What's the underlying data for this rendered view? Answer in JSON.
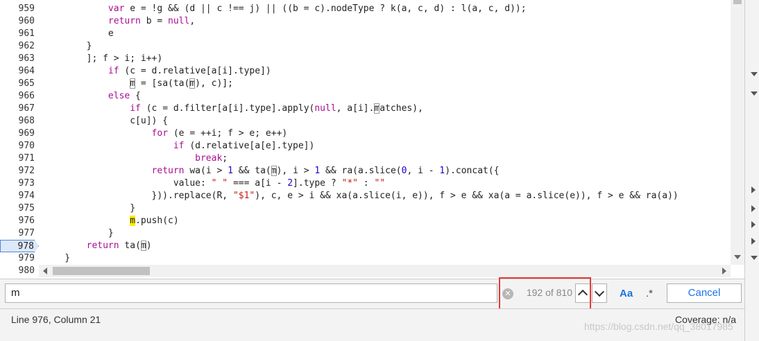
{
  "editor": {
    "active_line": "978",
    "lines": [
      {
        "num": "959",
        "tokens": [
          {
            "t": "            "
          },
          {
            "t": "var",
            "c": "kw"
          },
          {
            "t": " e = !g && (d || c !== j) || ((b = c).nodeType ? k(a, c, d) : l(a, c, d));"
          }
        ]
      },
      {
        "num": "960",
        "tokens": [
          {
            "t": "            "
          },
          {
            "t": "return",
            "c": "kw"
          },
          {
            "t": " b = "
          },
          {
            "t": "null",
            "c": "kw"
          },
          {
            "t": ","
          }
        ]
      },
      {
        "num": "961",
        "tokens": [
          {
            "t": "            e"
          }
        ]
      },
      {
        "num": "962",
        "tokens": [
          {
            "t": "        }"
          }
        ]
      },
      {
        "num": "963",
        "tokens": [
          {
            "t": "        ]; f > i; i++)"
          }
        ]
      },
      {
        "num": "964",
        "tokens": [
          {
            "t": "            "
          },
          {
            "t": "if",
            "c": "kw"
          },
          {
            "t": " (c = d.relative[a[i].type])"
          }
        ]
      },
      {
        "num": "965",
        "tokens": [
          {
            "t": "                "
          },
          {
            "t": "m",
            "c": "match"
          },
          {
            "t": " = [sa(ta("
          },
          {
            "t": "m",
            "c": "match"
          },
          {
            "t": "), c)];"
          }
        ]
      },
      {
        "num": "966",
        "tokens": [
          {
            "t": "            "
          },
          {
            "t": "else",
            "c": "kw"
          },
          {
            "t": " {"
          }
        ]
      },
      {
        "num": "967",
        "tokens": [
          {
            "t": "                "
          },
          {
            "t": "if",
            "c": "kw"
          },
          {
            "t": " (c = d.filter[a[i].type].apply("
          },
          {
            "t": "null",
            "c": "kw"
          },
          {
            "t": ", a[i]."
          },
          {
            "t": "m",
            "c": "match"
          },
          {
            "t": "atches),"
          }
        ]
      },
      {
        "num": "968",
        "tokens": [
          {
            "t": "                c[u]) {"
          }
        ]
      },
      {
        "num": "969",
        "tokens": [
          {
            "t": "                    "
          },
          {
            "t": "for",
            "c": "kw"
          },
          {
            "t": " (e = ++i; f > e; e++)"
          }
        ]
      },
      {
        "num": "970",
        "tokens": [
          {
            "t": "                        "
          },
          {
            "t": "if",
            "c": "kw"
          },
          {
            "t": " (d.relative[a[e].type])"
          }
        ]
      },
      {
        "num": "971",
        "tokens": [
          {
            "t": "                            "
          },
          {
            "t": "break",
            "c": "kw"
          },
          {
            "t": ";"
          }
        ]
      },
      {
        "num": "972",
        "tokens": [
          {
            "t": "                    "
          },
          {
            "t": "return",
            "c": "kw"
          },
          {
            "t": " wa(i > "
          },
          {
            "t": "1",
            "c": "num"
          },
          {
            "t": " && ta("
          },
          {
            "t": "m",
            "c": "match"
          },
          {
            "t": "), i > "
          },
          {
            "t": "1",
            "c": "num"
          },
          {
            "t": " && ra(a.slice("
          },
          {
            "t": "0",
            "c": "num"
          },
          {
            "t": ", i - "
          },
          {
            "t": "1",
            "c": "num"
          },
          {
            "t": ").concat({"
          }
        ]
      },
      {
        "num": "973",
        "tokens": [
          {
            "t": "                        value: "
          },
          {
            "t": "\" \"",
            "c": "str"
          },
          {
            "t": " === a[i - "
          },
          {
            "t": "2",
            "c": "num"
          },
          {
            "t": "].type ? "
          },
          {
            "t": "\"*\"",
            "c": "str"
          },
          {
            "t": " : "
          },
          {
            "t": "\"\"",
            "c": "str"
          }
        ]
      },
      {
        "num": "974",
        "tokens": [
          {
            "t": "                    })).replace(R, "
          },
          {
            "t": "\"$1\"",
            "c": "str"
          },
          {
            "t": "), c, e > i && xa(a.slice(i, e)), f > e && xa(a = a.slice(e)), f > e && ra(a))"
          }
        ]
      },
      {
        "num": "975",
        "tokens": [
          {
            "t": "                }"
          }
        ]
      },
      {
        "num": "976",
        "tokens": [
          {
            "t": "                "
          },
          {
            "t": "m",
            "c": "hl"
          },
          {
            "t": ".push(c)"
          }
        ]
      },
      {
        "num": "977",
        "tokens": [
          {
            "t": "            }"
          }
        ]
      },
      {
        "num": "978",
        "tokens": [
          {
            "t": "        "
          },
          {
            "t": "return",
            "c": "kw"
          },
          {
            "t": " ta("
          },
          {
            "t": "m",
            "c": "match"
          },
          {
            "t": ")"
          }
        ]
      },
      {
        "num": "979",
        "tokens": [
          {
            "t": "    }"
          }
        ]
      },
      {
        "num": "980",
        "tokens": [
          {
            "t": ""
          }
        ]
      }
    ]
  },
  "search": {
    "query": "m",
    "count": "192 of 810",
    "match_case_label": "Aa",
    "regex_label": ".*",
    "cancel_label": "Cancel"
  },
  "status": {
    "position": "Line 976, Column 21",
    "coverage": "Coverage: n/a"
  },
  "watermark": "https://blog.csdn.net/qq_38017985"
}
